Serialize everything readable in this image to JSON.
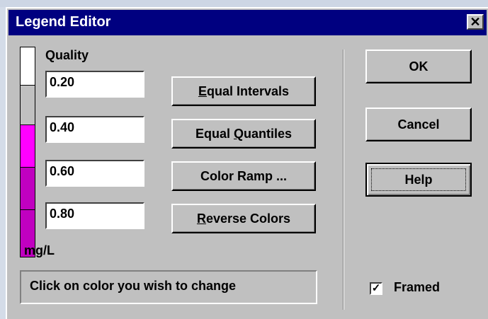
{
  "window": {
    "title": "Legend Editor"
  },
  "legend": {
    "title": "Quality",
    "units": "mg/L",
    "swatch_colors": [
      "#ffffff",
      "#c0c0c0",
      "#ff00ff",
      "#c000c0",
      "#c000c0"
    ],
    "values": [
      "0.20",
      "0.40",
      "0.60",
      "0.80"
    ]
  },
  "buttons": {
    "equal_intervals": {
      "mnemonic": "E",
      "rest": "qual Intervals"
    },
    "equal_quantiles": {
      "pre": "Equal ",
      "mnemonic": "Q",
      "rest": "uantiles"
    },
    "color_ramp": "Color Ramp ...",
    "reverse_colors": {
      "mnemonic": "R",
      "rest": "everse Colors"
    },
    "ok": "OK",
    "cancel": "Cancel",
    "help": "Help"
  },
  "status": "Click on color you wish to change",
  "framed": {
    "label": "Framed",
    "checked": true,
    "check_glyph": "✓"
  }
}
